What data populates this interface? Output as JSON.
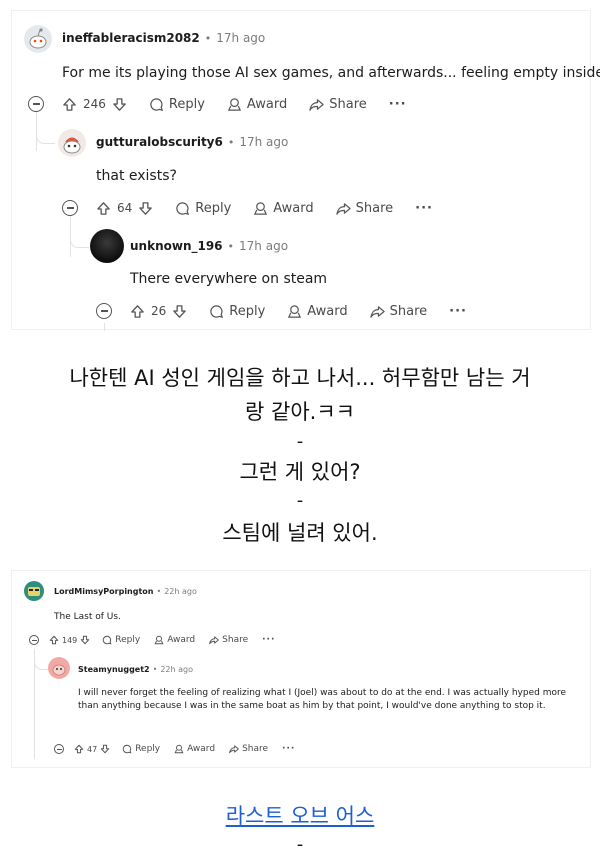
{
  "thread1": {
    "comment1": {
      "username": "ineffableracism2082",
      "time": "17h ago",
      "body": "For me its playing those AI sex games, and afterwards... feeling empty inside lol",
      "votes": "246",
      "reply_label": "Reply",
      "award_label": "Award",
      "share_label": "Share",
      "more_label": "···"
    },
    "comment2": {
      "username": "gutturalobscurity6",
      "time": "17h ago",
      "body": "that exists?",
      "votes": "64",
      "reply_label": "Reply",
      "award_label": "Award",
      "share_label": "Share",
      "more_label": "···"
    },
    "comment3": {
      "username": "unknown_196",
      "time": "17h ago",
      "body": "There everywhere on steam",
      "votes": "26",
      "reply_label": "Reply",
      "award_label": "Award",
      "share_label": "Share",
      "more_label": "···"
    }
  },
  "translation1": {
    "line1": "나한텐 AI 성인 게임을 하고 나서... 허무함만 남는 거",
    "line2": "랑 같아.ㅋㅋ",
    "sep1": "-",
    "line3": "그런 게 있어?",
    "sep2": "-",
    "line4": "스팀에 널려 있어."
  },
  "thread2": {
    "comment1": {
      "username": "LordMimsyPorpington",
      "time": "22h ago",
      "body": "The Last of Us.",
      "votes": "149",
      "reply_label": "Reply",
      "award_label": "Award",
      "share_label": "Share",
      "more_label": "···"
    },
    "comment2": {
      "username": "Steamynugget2",
      "time": "22h ago",
      "body": "I will never forget the feeling of realizing what I (Joel) was about to do at the end. I was actually hyped more than anything because I was in the same boat as him by that point, I would've done anything to stop it.",
      "votes": "47",
      "reply_label": "Reply",
      "award_label": "Award",
      "share_label": "Share",
      "more_label": "···"
    }
  },
  "translation2": {
    "link": "라스트 오브 어스",
    "sep": "-"
  },
  "colors": {
    "text": "#1c1c1c",
    "meta": "#7c7c7c",
    "link": "#1a5fd6",
    "thread_line": "#e2e2e2"
  }
}
